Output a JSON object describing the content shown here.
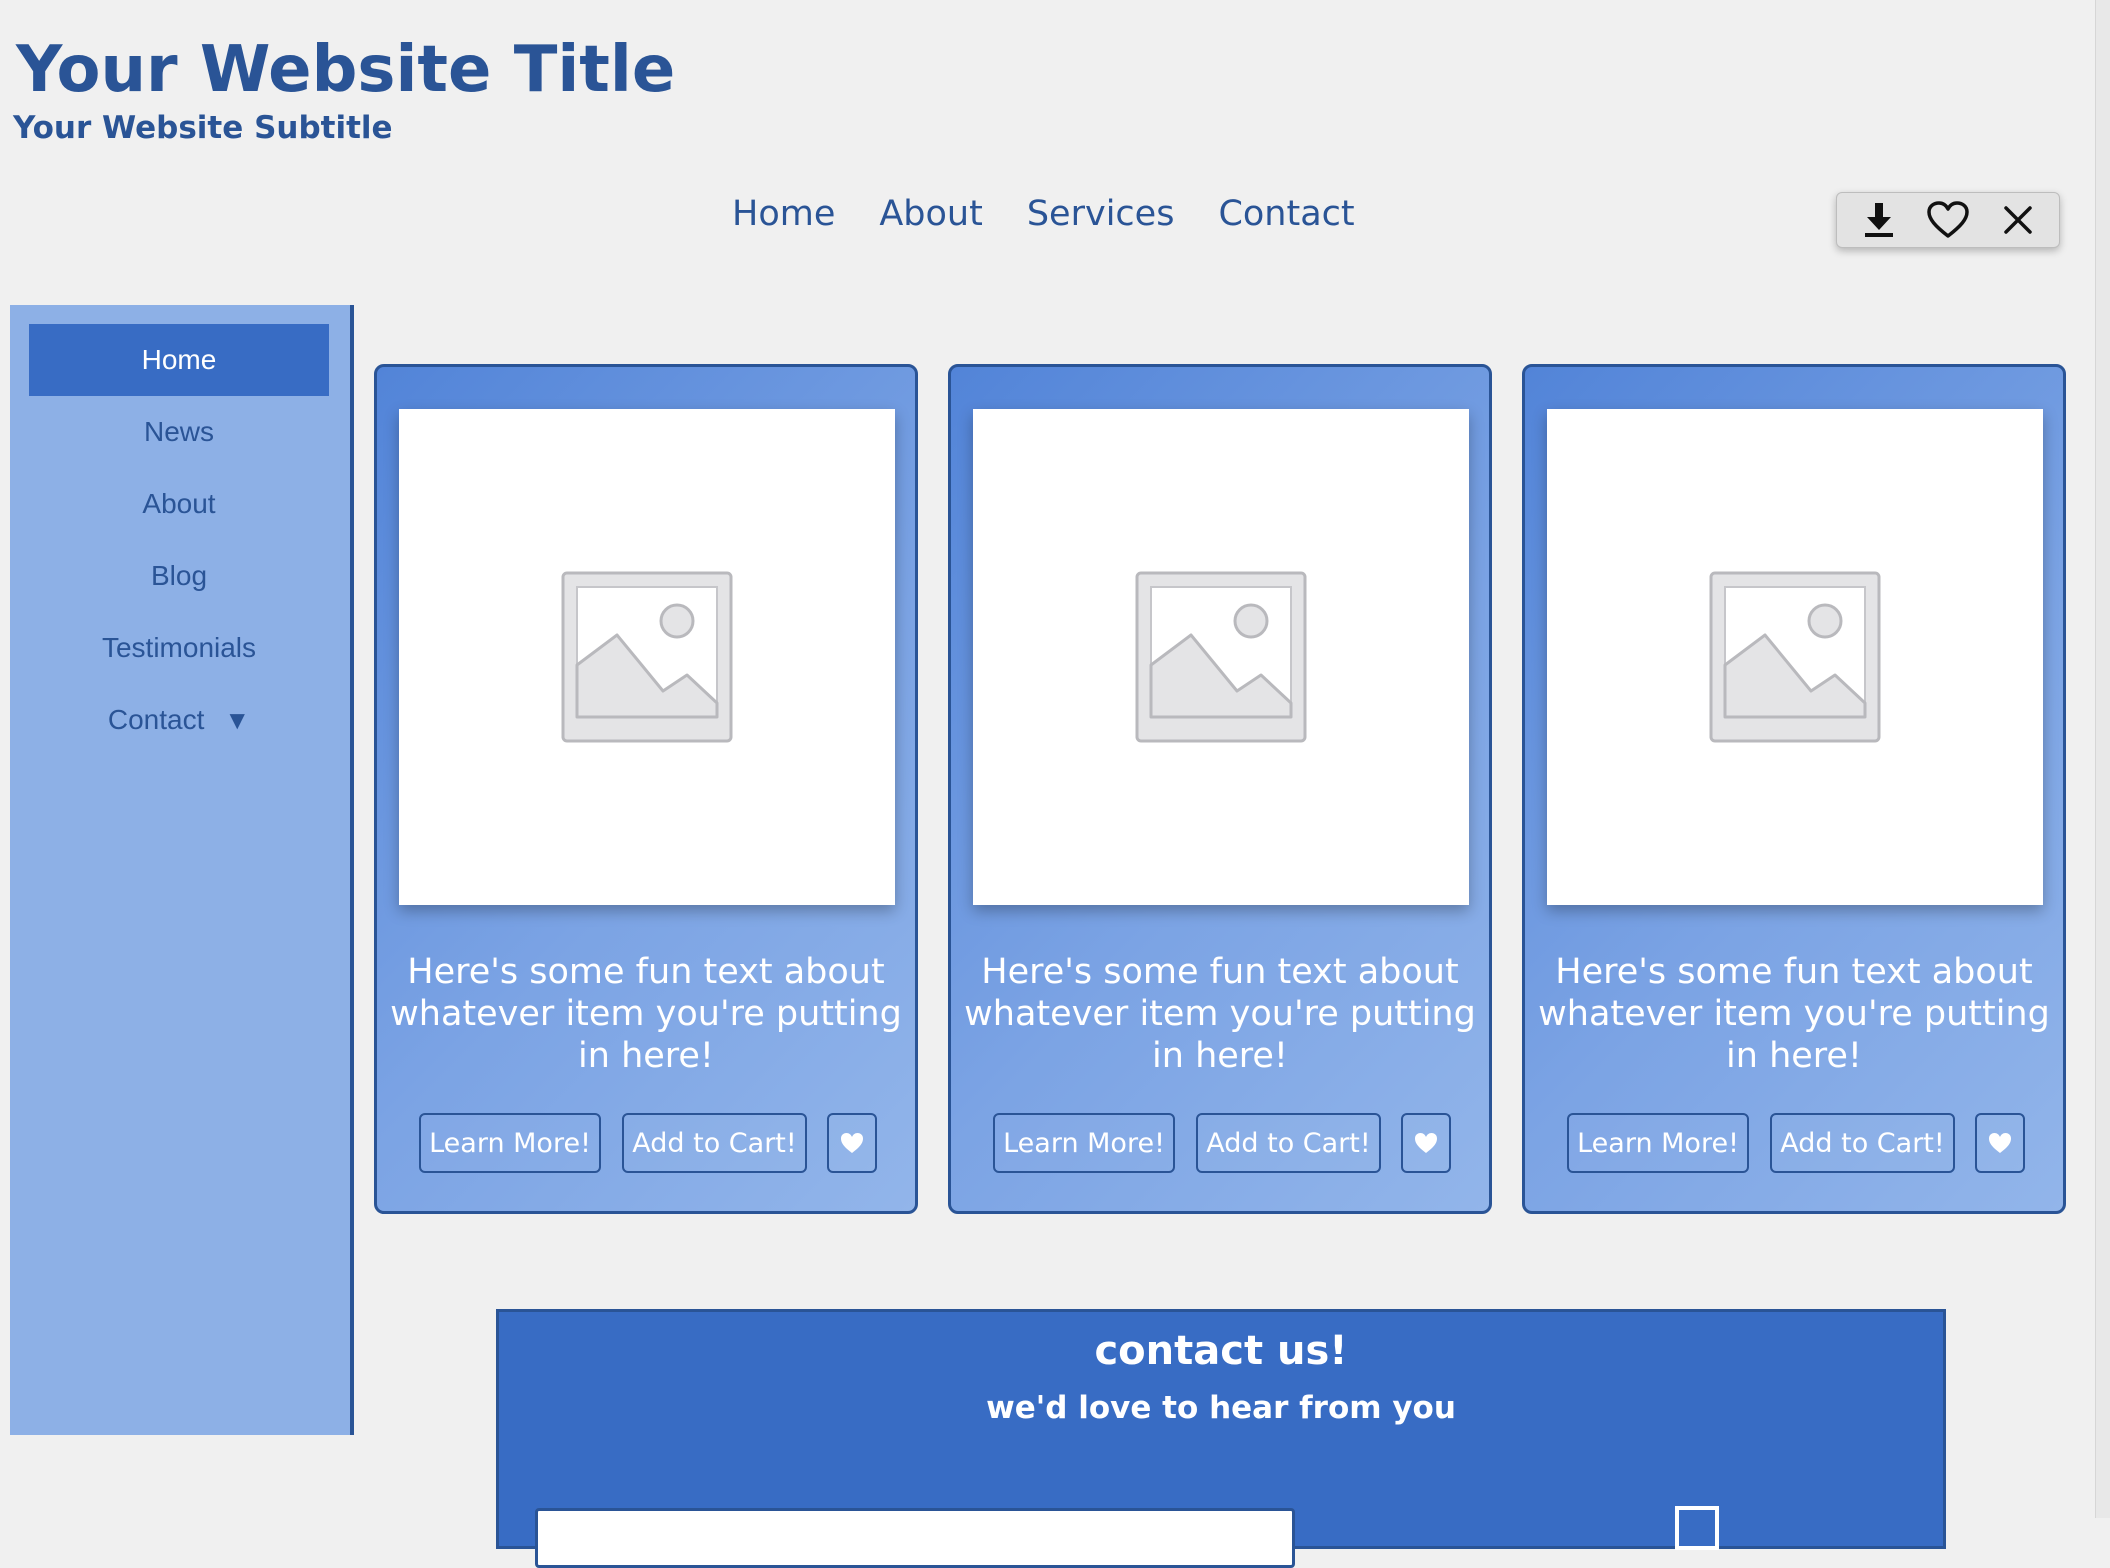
{
  "header": {
    "title": "Your Website Title",
    "subtitle": "Your Website Subtitle"
  },
  "top_nav": [
    "Home",
    "About",
    "Services",
    "Contact"
  ],
  "toolbar": {
    "icons": [
      "download-icon",
      "heart-outline-icon",
      "close-icon"
    ]
  },
  "sidebar": {
    "items": [
      {
        "label": "Home",
        "active": true
      },
      {
        "label": "News"
      },
      {
        "label": "About"
      },
      {
        "label": "Blog"
      },
      {
        "label": "Testimonials"
      },
      {
        "label": "Contact",
        "caret": "▼"
      }
    ]
  },
  "cards": [
    {
      "image": "image-placeholder-icon",
      "text": "Here's some fun text about whatever item you're putting in here!",
      "learn_more": "Learn More!",
      "add_to_cart": "Add to Cart!",
      "favorite_icon": "heart-icon"
    },
    {
      "image": "image-placeholder-icon",
      "text": "Here's some fun text about whatever item you're putting in here!",
      "learn_more": "Learn More!",
      "add_to_cart": "Add to Cart!",
      "favorite_icon": "heart-icon"
    },
    {
      "image": "image-placeholder-icon",
      "text": "Here's some fun text about whatever item you're putting in here!",
      "learn_more": "Learn More!",
      "add_to_cart": "Add to Cart!",
      "favorite_icon": "heart-icon"
    }
  ],
  "contact": {
    "title": "contact us!",
    "subtitle": "we'd love to hear from you"
  },
  "colors": {
    "primary": "#2a5496",
    "accent": "#386cc4",
    "sidebar_bg": "#8db0e6",
    "page_bg": "#f0f0f0"
  }
}
